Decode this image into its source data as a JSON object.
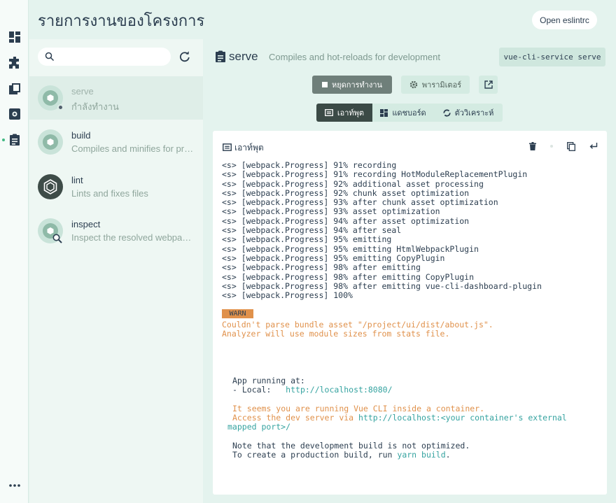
{
  "page_title": "รายการงานของโครงการ",
  "header": {
    "open_eslint_label": "Open eslintrc"
  },
  "rail": {
    "icons": [
      "dashboard-icon",
      "plugins-icon",
      "dependencies-icon",
      "configuration-icon",
      "tasks-icon",
      "more-icon"
    ]
  },
  "search": {
    "value": "",
    "placeholder": ""
  },
  "tasks": [
    {
      "name": "serve",
      "description": "กำลังทำงาน",
      "active": true
    },
    {
      "name": "build",
      "description": "Compiles and minifies for production"
    },
    {
      "name": "lint",
      "description": "Lints and fixes files"
    },
    {
      "name": "inspect",
      "description": "Inspect the resolved webpack config"
    }
  ],
  "detail": {
    "title": "serve",
    "subtitle": "Compiles and hot-reloads for development",
    "command": "vue-cli-service serve",
    "stop_label": "หยุดการทำงาน",
    "params_label": "พารามิเตอร์",
    "tabs": [
      {
        "label": "เอาท์พุต",
        "active": true
      },
      {
        "label": "แดชบอร์ด"
      },
      {
        "label": "ตัววิเคราะห์"
      }
    ]
  },
  "console": {
    "title": "เอาท์พุต",
    "lines": [
      "<s> [webpack.Progress] 91% recording",
      "<s> [webpack.Progress] 91% recording HotModuleReplacementPlugin",
      "<s> [webpack.Progress] 92% additional asset processing",
      "<s> [webpack.Progress] 92% chunk asset optimization",
      "<s> [webpack.Progress] 93% after chunk asset optimization",
      "<s> [webpack.Progress] 93% asset optimization",
      "<s> [webpack.Progress] 94% after asset optimization",
      "<s> [webpack.Progress] 94% after seal",
      "<s> [webpack.Progress] 95% emitting",
      "<s> [webpack.Progress] 95% emitting HtmlWebpackPlugin",
      "<s> [webpack.Progress] 95% emitting CopyPlugin",
      "<s> [webpack.Progress] 98% after emitting",
      "<s> [webpack.Progress] 98% after emitting CopyPlugin",
      "<s> [webpack.Progress] 98% after emitting vue-cli-dashboard-plugin",
      "<s> [webpack.Progress] 100%"
    ],
    "warn_tag": "WARN",
    "warn_line1": "Couldn't parse bundle asset \"/project/ui/dist/about.js\".",
    "warn_line2": "Analyzer will use module sizes from stats file.",
    "app_running": "App running at:",
    "local_label": "- Local:   ",
    "local_url": "http://localhost:8080/",
    "container_line1": "It seems you are running Vue CLI inside a container.",
    "container_line2a": "Access the dev server via ",
    "container_line2b": "http://localhost:<your container's external",
    "container_line3": "mapped port>/",
    "note_line1": "Note that the development build is not optimized.",
    "note_line2a": "To create a production build, run ",
    "note_line2b": "yarn build",
    "note_line2c": "."
  }
}
